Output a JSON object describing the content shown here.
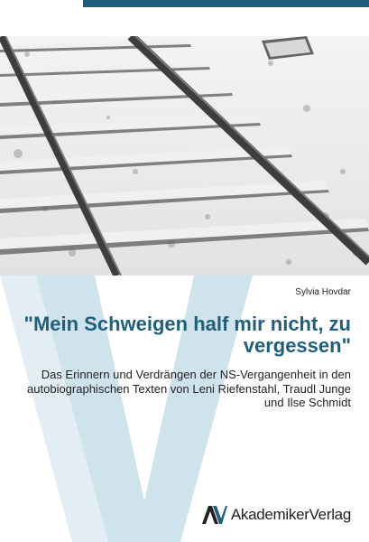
{
  "book": {
    "author": "Sylvia Hovdar",
    "title": "\"Mein Schweigen half mir nicht, zu vergessen\"",
    "subtitle": "Das Erinnern und Verdrängen der NS-Vergangenheit in den autobiographischen Texten von Leni Riefenstahl, Traudl Junge und Ilse Schmidt"
  },
  "publisher": {
    "name": "AkademikerVerlag"
  },
  "colors": {
    "accent": "#1f5e7c",
    "logo_light": "#cfe3ed"
  }
}
